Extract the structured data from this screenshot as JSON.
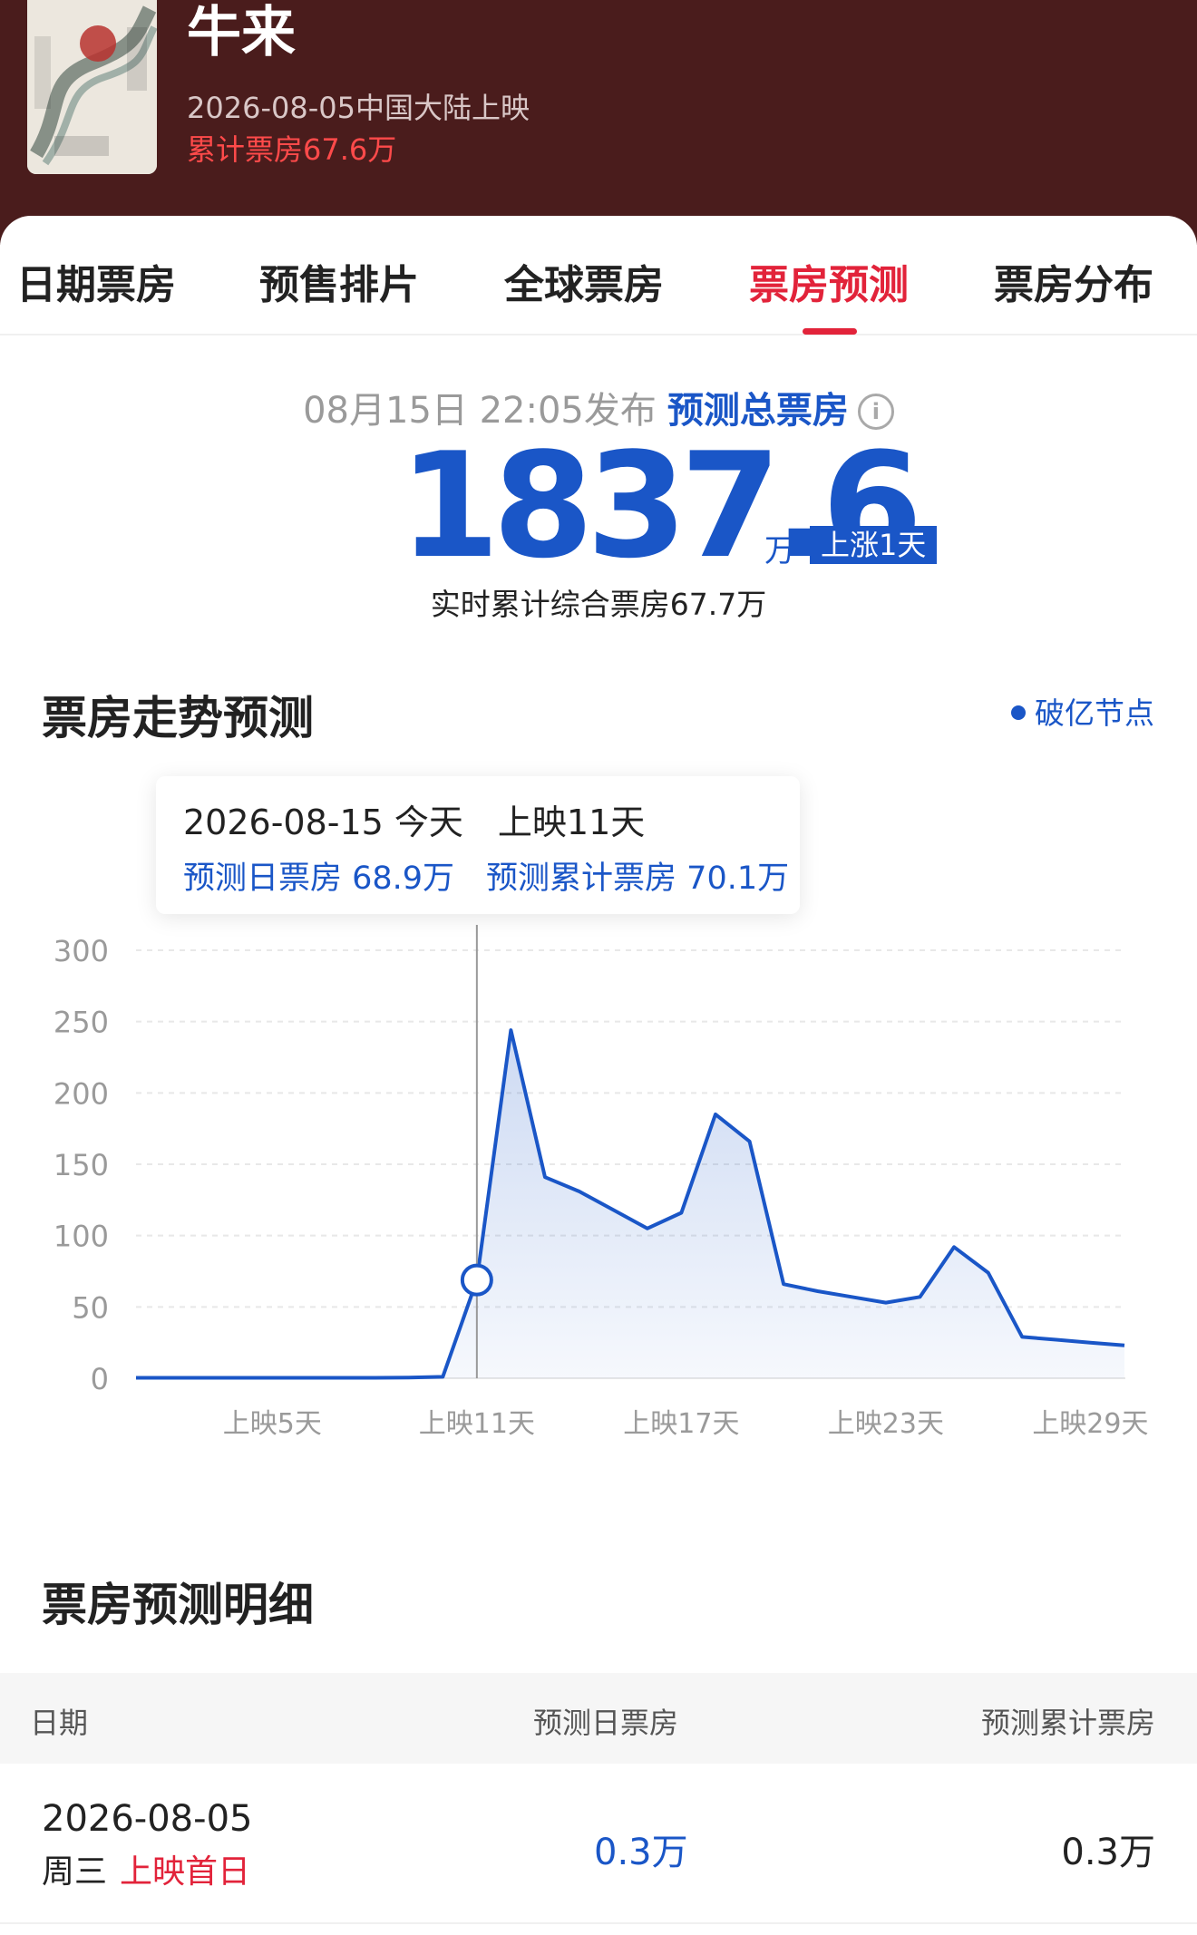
{
  "movie": {
    "title": "牛来",
    "release": "2026-08-05中国大陆上映",
    "total": "累计票房67.6万"
  },
  "tabs": [
    {
      "label": "日期票房",
      "active": false
    },
    {
      "label": "预售排片",
      "active": false
    },
    {
      "label": "全球票房",
      "active": false
    },
    {
      "label": "票房预测",
      "active": true
    },
    {
      "label": "票房分布",
      "active": false
    }
  ],
  "forecast": {
    "publish_time": "08月15日 22:05发布",
    "label": "预测总票房",
    "info_icon": "info-icon",
    "total_value": "1837.6",
    "unit": "万",
    "badge": "上涨1天",
    "realtime": "实时累计综合票房67.7万"
  },
  "trend": {
    "title": "票房走势预测",
    "milestone_label": "破亿节点"
  },
  "tooltip": {
    "line1": "2026-08-15 今天　上映11天",
    "line2": "预测日票房 68.9万　预测累计票房 70.1万"
  },
  "chart_data": {
    "type": "area",
    "x": [
      1,
      2,
      3,
      4,
      5,
      6,
      7,
      8,
      9,
      10,
      11,
      12,
      13,
      14,
      15,
      16,
      17,
      18,
      19,
      20,
      21,
      22,
      23,
      24,
      25,
      26,
      27,
      28,
      29,
      30
    ],
    "x_tick_labels": [
      {
        "x": 5,
        "label": "上映5天"
      },
      {
        "x": 11,
        "label": "上映11天"
      },
      {
        "x": 17,
        "label": "上映17天"
      },
      {
        "x": 23,
        "label": "上映23天"
      },
      {
        "x": 29,
        "label": "上映29天"
      }
    ],
    "series": [
      {
        "values": [
          0.3,
          0.3,
          0.3,
          0.3,
          0.3,
          0.3,
          0.3,
          0.3,
          0.5,
          1,
          68.9,
          244,
          141,
          131,
          118,
          105,
          116,
          185,
          166,
          66,
          61,
          57,
          53,
          57,
          92,
          74,
          29,
          27,
          25,
          23
        ]
      }
    ],
    "ylim": [
      0,
      300
    ],
    "yticks": [
      0,
      50,
      100,
      150,
      200,
      250,
      300
    ],
    "grid": true,
    "highlight_x": 11,
    "color": "#1a56c7"
  },
  "detail": {
    "title": "票房预测明细",
    "columns": [
      "日期",
      "预测日票房",
      "预测累计票房"
    ],
    "rows": [
      {
        "date": "2026-08-05",
        "week": "周三",
        "tag": "上映首日",
        "daily": "0.3万",
        "cumulative": "0.3万"
      }
    ]
  },
  "colors": {
    "header_bg": "#4a1c1c",
    "accent_red": "#e2233a",
    "accent_blue": "#1a56c7"
  }
}
